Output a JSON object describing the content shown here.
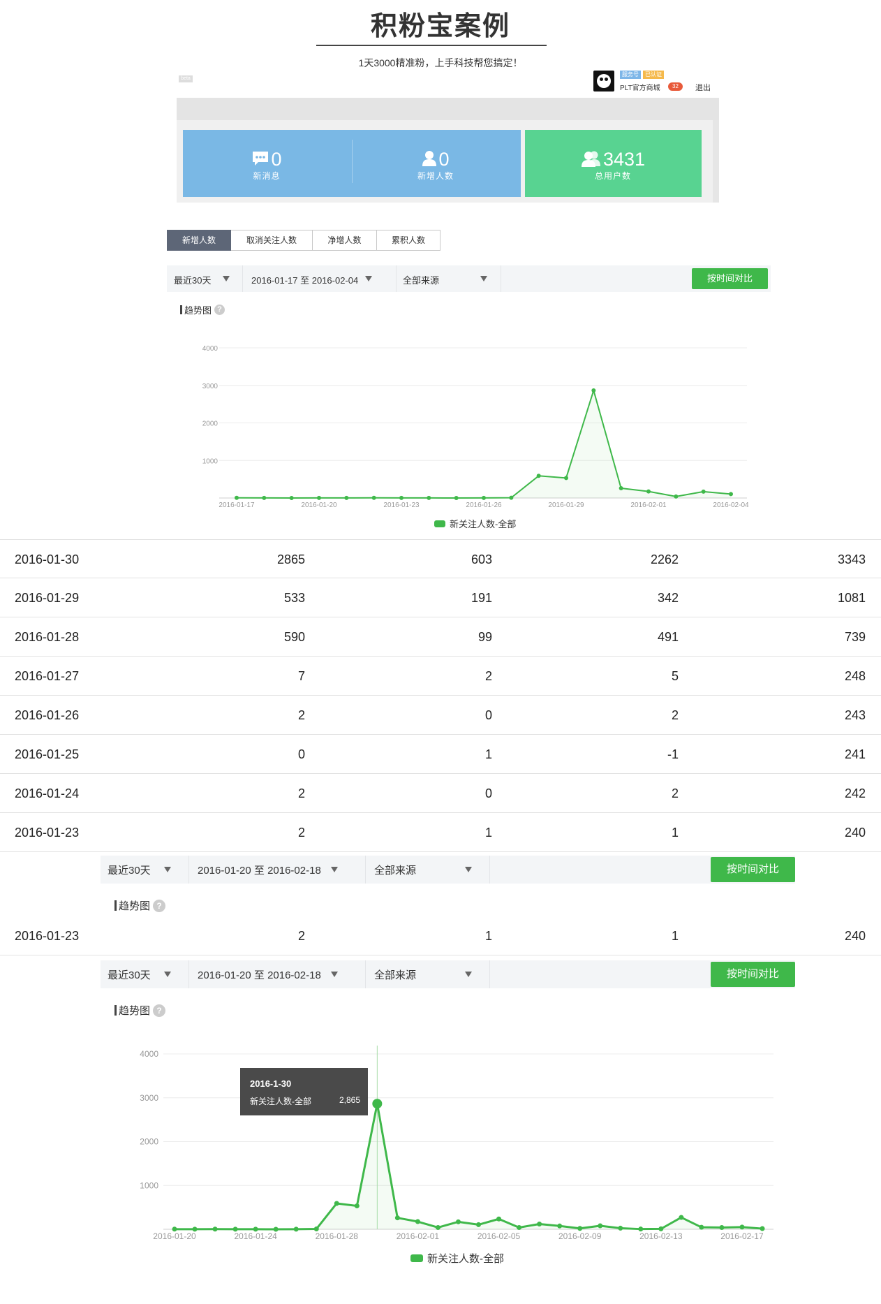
{
  "header": {
    "title": "积粉宝案例",
    "subtitle": "1天3000精准粉，上手科技帮您搞定！"
  },
  "account": {
    "beta_badge": "beta",
    "service_tag": "服务号",
    "verified_tag": "已认证",
    "name": "PLT官方商城",
    "notifications": "32",
    "logout": "退出"
  },
  "stats": {
    "messages": {
      "value": "0",
      "label": "新消息"
    },
    "new_users": {
      "value": "0",
      "label": "新增人数"
    },
    "total_users": {
      "value": "3431",
      "label": "总用户数"
    }
  },
  "tabs": [
    "新增人数",
    "取消关注人数",
    "净增人数",
    "累积人数"
  ],
  "toolbar1": {
    "period": "最近30天",
    "date_range": "2016-01-17 至 2016-02-04",
    "source": "全部来源",
    "compare_button": "按时间对比"
  },
  "toolbar2": {
    "period": "最近30天",
    "date_range": "2016-01-20 至 2016-02-18",
    "source": "全部来源",
    "compare_button": "按时间对比"
  },
  "section_label": "趋势图",
  "help_glyph": "?",
  "legend_label": "新关注人数-全部",
  "table_rows": [
    {
      "date": "2016-01-30",
      "a": "2865",
      "b": "603",
      "c": "2262",
      "d": "3343"
    },
    {
      "date": "2016-01-29",
      "a": "533",
      "b": "191",
      "c": "342",
      "d": "1081"
    },
    {
      "date": "2016-01-28",
      "a": "590",
      "b": "99",
      "c": "491",
      "d": "739"
    },
    {
      "date": "2016-01-27",
      "a": "7",
      "b": "2",
      "c": "5",
      "d": "248"
    },
    {
      "date": "2016-01-26",
      "a": "2",
      "b": "0",
      "c": "2",
      "d": "243"
    },
    {
      "date": "2016-01-25",
      "a": "0",
      "b": "1",
      "c": "-1",
      "d": "241"
    },
    {
      "date": "2016-01-24",
      "a": "2",
      "b": "0",
      "c": "2",
      "d": "242"
    },
    {
      "date": "2016-01-23",
      "a": "2",
      "b": "1",
      "c": "1",
      "d": "240"
    }
  ],
  "table_row_repeat": {
    "date": "2016-01-23",
    "a": "2",
    "b": "1",
    "c": "1",
    "d": "240"
  },
  "tooltip": {
    "date": "2016-1-30",
    "label": "新关注人数-全部",
    "value": "2,865"
  },
  "colors": {
    "line": "#3fb84a",
    "blue_panel": "#7ab8e5",
    "green_panel": "#58d391",
    "active_tab": "#5d6677"
  },
  "icons": {
    "message": "message-icon",
    "user": "user-icon",
    "users": "users-icon",
    "dropdown": "triangle-down-icon",
    "help": "help-icon"
  },
  "chart_data": [
    {
      "type": "line",
      "title": "",
      "xlabel": "",
      "ylabel": "",
      "ylim": [
        0,
        4000
      ],
      "y_ticks": [
        "4000",
        "3000",
        "2000",
        "1000"
      ],
      "x_tick_labels": [
        "2016-01-17",
        "2016-01-20",
        "2016-01-23",
        "2016-01-26",
        "2016-01-29",
        "2016-02-01",
        "2016-02-04"
      ],
      "x": [
        "2016-01-17",
        "2016-01-18",
        "2016-01-19",
        "2016-01-20",
        "2016-01-21",
        "2016-01-22",
        "2016-01-23",
        "2016-01-24",
        "2016-01-25",
        "2016-01-26",
        "2016-01-27",
        "2016-01-28",
        "2016-01-29",
        "2016-01-30",
        "2016-01-31",
        "2016-02-01",
        "2016-02-02",
        "2016-02-03",
        "2016-02-04"
      ],
      "series": [
        {
          "name": "新关注人数-全部",
          "values": [
            5,
            2,
            1,
            3,
            2,
            4,
            2,
            2,
            0,
            2,
            7,
            590,
            533,
            2865,
            260,
            175,
            40,
            170,
            105
          ]
        }
      ],
      "grid": true,
      "legend": "bottom-center"
    },
    {
      "type": "line",
      "title": "",
      "xlabel": "",
      "ylabel": "",
      "ylim": [
        0,
        4000
      ],
      "y_ticks": [
        "4000",
        "3000",
        "2000",
        "1000"
      ],
      "x_tick_labels": [
        "2016-01-20",
        "2016-01-24",
        "2016-01-28",
        "2016-02-01",
        "2016-02-05",
        "2016-02-09",
        "2016-02-13",
        "2016-02-17"
      ],
      "x": [
        "2016-01-20",
        "2016-01-21",
        "2016-01-22",
        "2016-01-23",
        "2016-01-24",
        "2016-01-25",
        "2016-01-26",
        "2016-01-27",
        "2016-01-28",
        "2016-01-29",
        "2016-01-30",
        "2016-01-31",
        "2016-02-01",
        "2016-02-02",
        "2016-02-03",
        "2016-02-04",
        "2016-02-05",
        "2016-02-06",
        "2016-02-07",
        "2016-02-08",
        "2016-02-09",
        "2016-02-10",
        "2016-02-11",
        "2016-02-12",
        "2016-02-13",
        "2016-02-14",
        "2016-02-15",
        "2016-02-16",
        "2016-02-17",
        "2016-02-18"
      ],
      "series": [
        {
          "name": "新关注人数-全部",
          "values": [
            3,
            2,
            4,
            2,
            2,
            0,
            2,
            7,
            590,
            533,
            2865,
            260,
            175,
            40,
            170,
            105,
            235,
            40,
            120,
            75,
            20,
            80,
            25,
            5,
            10,
            270,
            45,
            40,
            50,
            15
          ]
        }
      ],
      "grid": true,
      "legend": "bottom-center",
      "tooltip_index": 10
    }
  ]
}
